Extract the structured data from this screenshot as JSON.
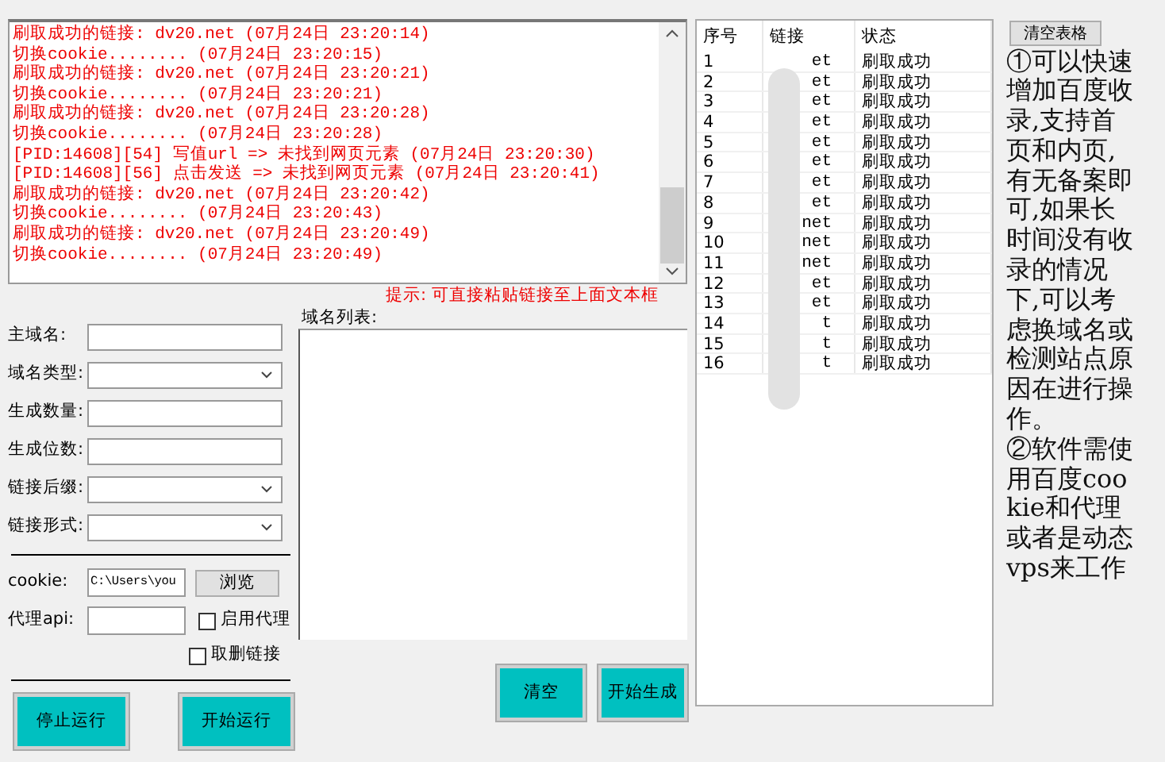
{
  "log": [
    "刷取成功的链接: dv20.net (07月24日 23:20:14)",
    "切换cookie........ (07月24日 23:20:15)",
    "刷取成功的链接: dv20.net (07月24日 23:20:21)",
    "切换cookie........ (07月24日 23:20:21)",
    "刷取成功的链接: dv20.net (07月24日 23:20:28)",
    "切换cookie........ (07月24日 23:20:28)",
    "[PID:14608][54] 写值url => 未找到网页元素 (07月24日 23:20:30)",
    "[PID:14608][56] 点击发送 => 未找到网页元素 (07月24日 23:20:41)",
    "刷取成功的链接: dv20.net (07月24日 23:20:42)",
    "切换cookie........ (07月24日 23:20:43)",
    "刷取成功的链接: dv20.net (07月24日 23:20:49)",
    "切换cookie........ (07月24日 23:20:49)"
  ],
  "form": [
    {
      "kind": "text",
      "label": "主域名:"
    },
    {
      "kind": "select",
      "label": "域名类型:"
    },
    {
      "kind": "text",
      "label": "生成数量:"
    },
    {
      "kind": "text",
      "label": "生成位数:"
    },
    {
      "kind": "select",
      "label": "链接后缀:"
    },
    {
      "kind": "select",
      "label": "链接形式:"
    }
  ],
  "cookie": {
    "label": "cookie:",
    "value": "C:\\Users\\you",
    "button": "浏览"
  },
  "proxy": {
    "label": "代理api:"
  },
  "checkboxes": [
    {
      "label": "启用代理",
      "checked": false
    },
    {
      "label": "取删链接",
      "checked": false
    }
  ],
  "hint": "提示: 可直接粘贴链接至上面文本框",
  "domain_list": {
    "label": "域名列表:"
  },
  "buttons_left": [
    "停止运行",
    "开始运行"
  ],
  "buttons_right": [
    "清空",
    "开始生成"
  ],
  "table": {
    "columns": [
      "序号",
      "链接",
      "状态"
    ],
    "rows": [
      [
        "1",
        "et",
        "刷取成功"
      ],
      [
        "2",
        "et",
        "刷取成功"
      ],
      [
        "3",
        "et",
        "刷取成功"
      ],
      [
        "4",
        "et",
        "刷取成功"
      ],
      [
        "5",
        "et",
        "刷取成功"
      ],
      [
        "6",
        "et",
        "刷取成功"
      ],
      [
        "7",
        "et",
        "刷取成功"
      ],
      [
        "8",
        "et",
        "刷取成功"
      ],
      [
        "9",
        "net",
        "刷取成功"
      ],
      [
        "10",
        "net",
        "刷取成功"
      ],
      [
        "11",
        "net",
        "刷取成功"
      ],
      [
        "12",
        "et",
        "刷取成功"
      ],
      [
        "13",
        "et",
        "刷取成功"
      ],
      [
        "14",
        "t",
        "刷取成功"
      ],
      [
        "15",
        "t",
        "刷取成功"
      ],
      [
        "16",
        "t",
        "刷取成功"
      ]
    ]
  },
  "clear_table_button": "清空表格",
  "notes": [
    "①可以快速增加百度收录,支持首页和内页,有无备案即可,如果长时间没有收录的情况下,可以考虑换域名或检测站点原因在进行操作。",
    "②软件需使用百度cookie和代理或者是动态vps来工作"
  ]
}
